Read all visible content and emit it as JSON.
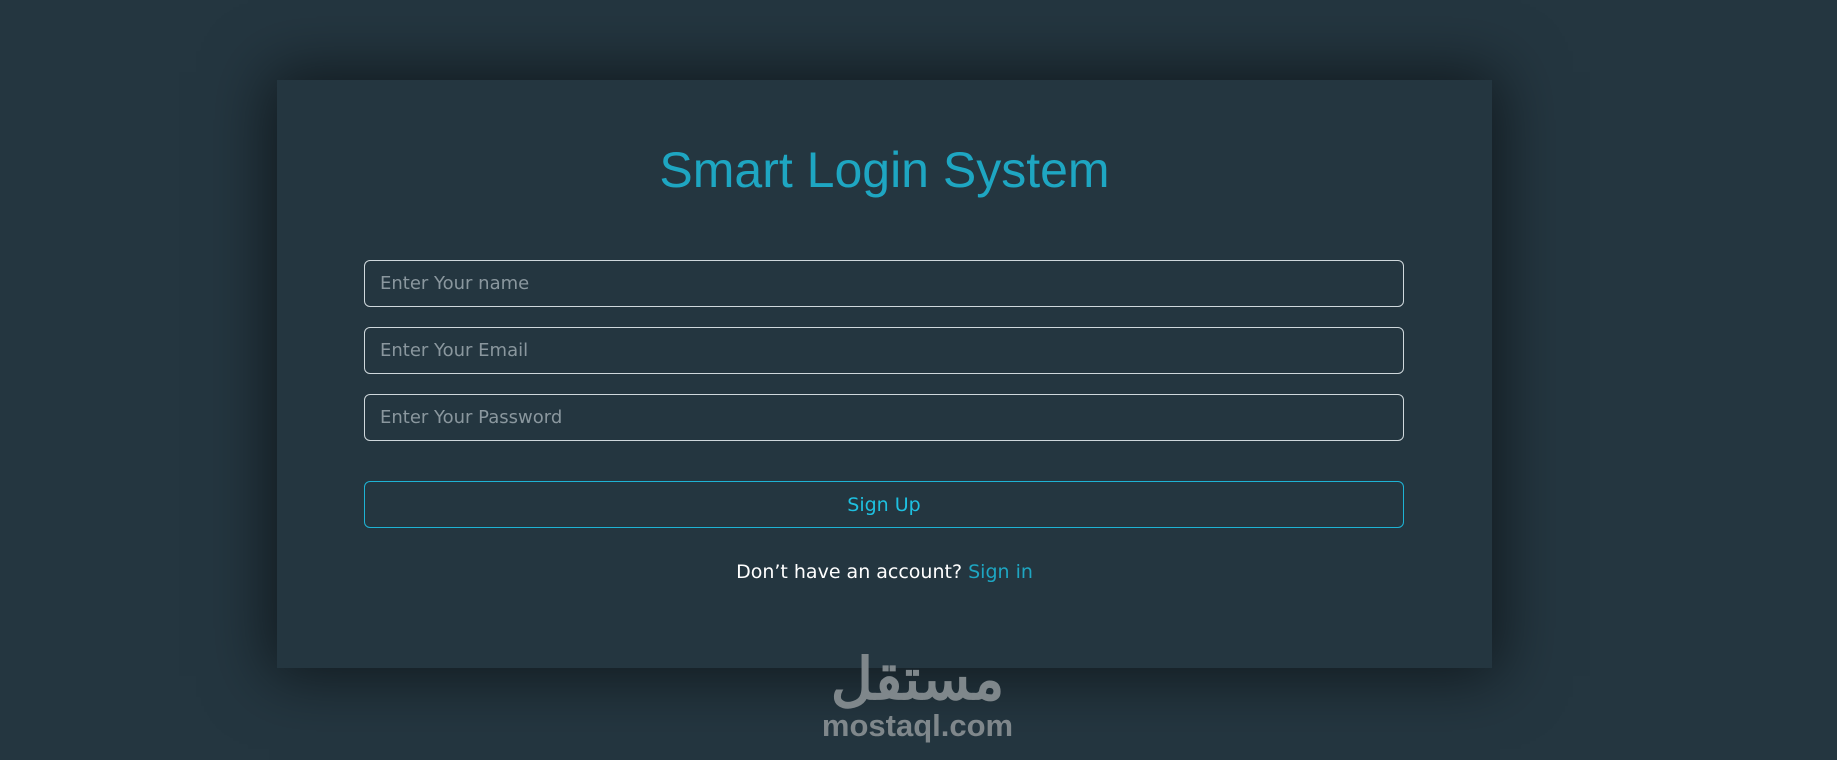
{
  "form": {
    "title": "Smart Login System",
    "name_placeholder": "Enter Your name",
    "email_placeholder": "Enter Your Email",
    "password_placeholder": "Enter Your Password",
    "submit_label": "Sign Up",
    "footer_text": "Don’t have an account?",
    "footer_link": "Sign in"
  },
  "watermark": {
    "arabic": "مستقل",
    "latin": "mostaql.com"
  },
  "colors": {
    "background": "#243640",
    "accent": "#1ea6c2",
    "border": "#cfd8dc"
  }
}
